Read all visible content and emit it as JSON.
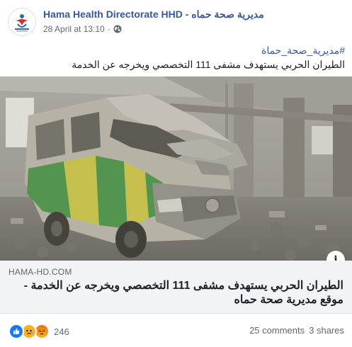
{
  "page": {
    "name": "Hama Health Directorate HHD - مديرية صحة حماه",
    "date": "28 April at 13:10",
    "separator": "·"
  },
  "post": {
    "hashtag": "#مديرية_صحة_حماة",
    "text": "الطيران الحربي يستهدف مشفى 111 التخصصي ويخرجه عن الخدمة"
  },
  "link": {
    "domain": "HAMA-HD.COM",
    "title": "الطيران الحربي يستهدف مشفى 111 التخصصي ويخرجه عن الخدمة - موقع مديرية صحة حماه",
    "info_glyph": "i"
  },
  "engagement": {
    "reaction_count": "246",
    "comments": "25 comments",
    "shares": "3 shares",
    "reactions": [
      "like-icon",
      "sad-icon",
      "angry-icon"
    ]
  },
  "colors": {
    "link_blue": "#385898",
    "like_blue": "#1877f2"
  }
}
